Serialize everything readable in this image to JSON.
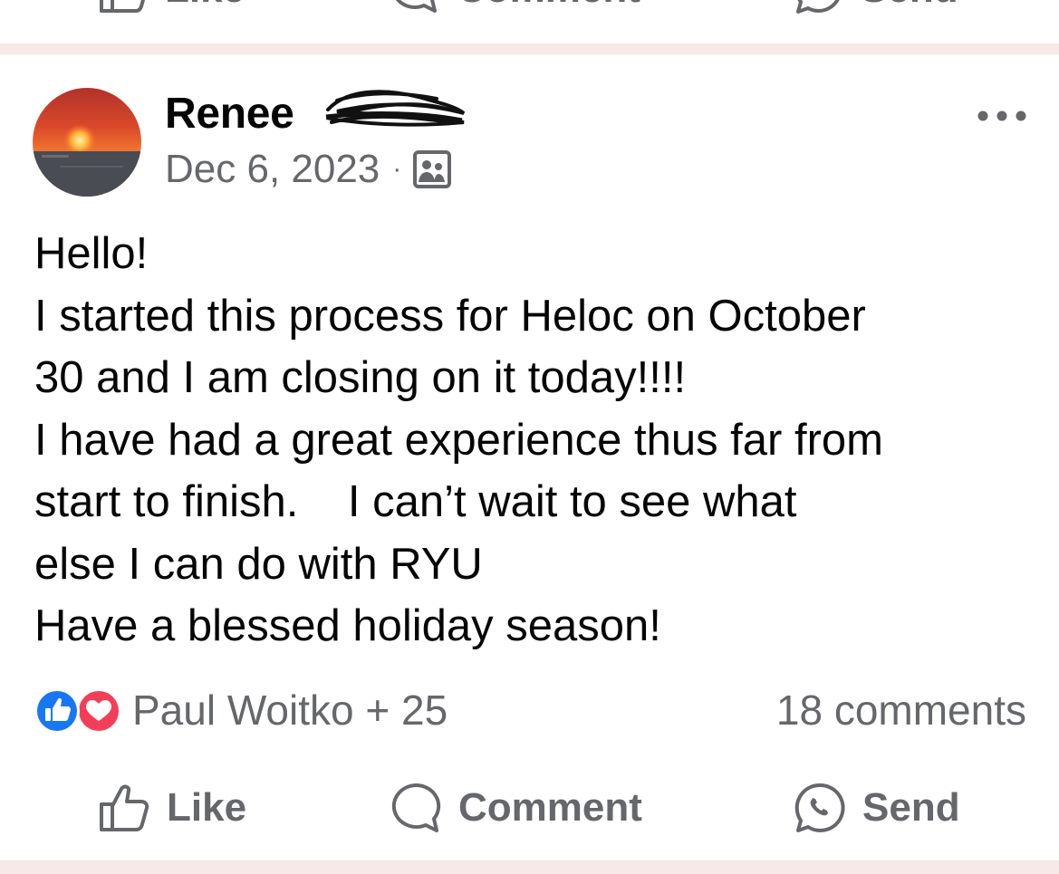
{
  "previous_post": {
    "actions": {
      "like_label": "Like",
      "comment_label": "Comment",
      "send_label": "Send"
    }
  },
  "post": {
    "author": "Renee",
    "author_surname_redacted": true,
    "date": "Dec 6, 2023",
    "separator": "·",
    "audience_icon": "friends-audience-icon",
    "more_icon": "more-options-icon",
    "body_lines": [
      "Hello!",
      "I started this process for Heloc on October",
      "30 and I am closing on it today!!!!",
      "I have had a great experience thus far from",
      "start to finish.    I can’t wait to see what",
      "else I can do with RYU",
      "Have a blessed holiday season!"
    ],
    "reactions": {
      "icons": [
        "like-reaction-icon",
        "love-reaction-icon"
      ],
      "summary": "Paul Woitko + 25"
    },
    "comments_count": "18 comments",
    "actions": {
      "like_label": "Like",
      "comment_label": "Comment",
      "send_label": "Send"
    }
  },
  "colors": {
    "text_primary": "#050505",
    "text_secondary": "#65676b",
    "divider": "#f7e9e8",
    "like_blue": "#1877f2",
    "love_red": "#f33e58"
  }
}
